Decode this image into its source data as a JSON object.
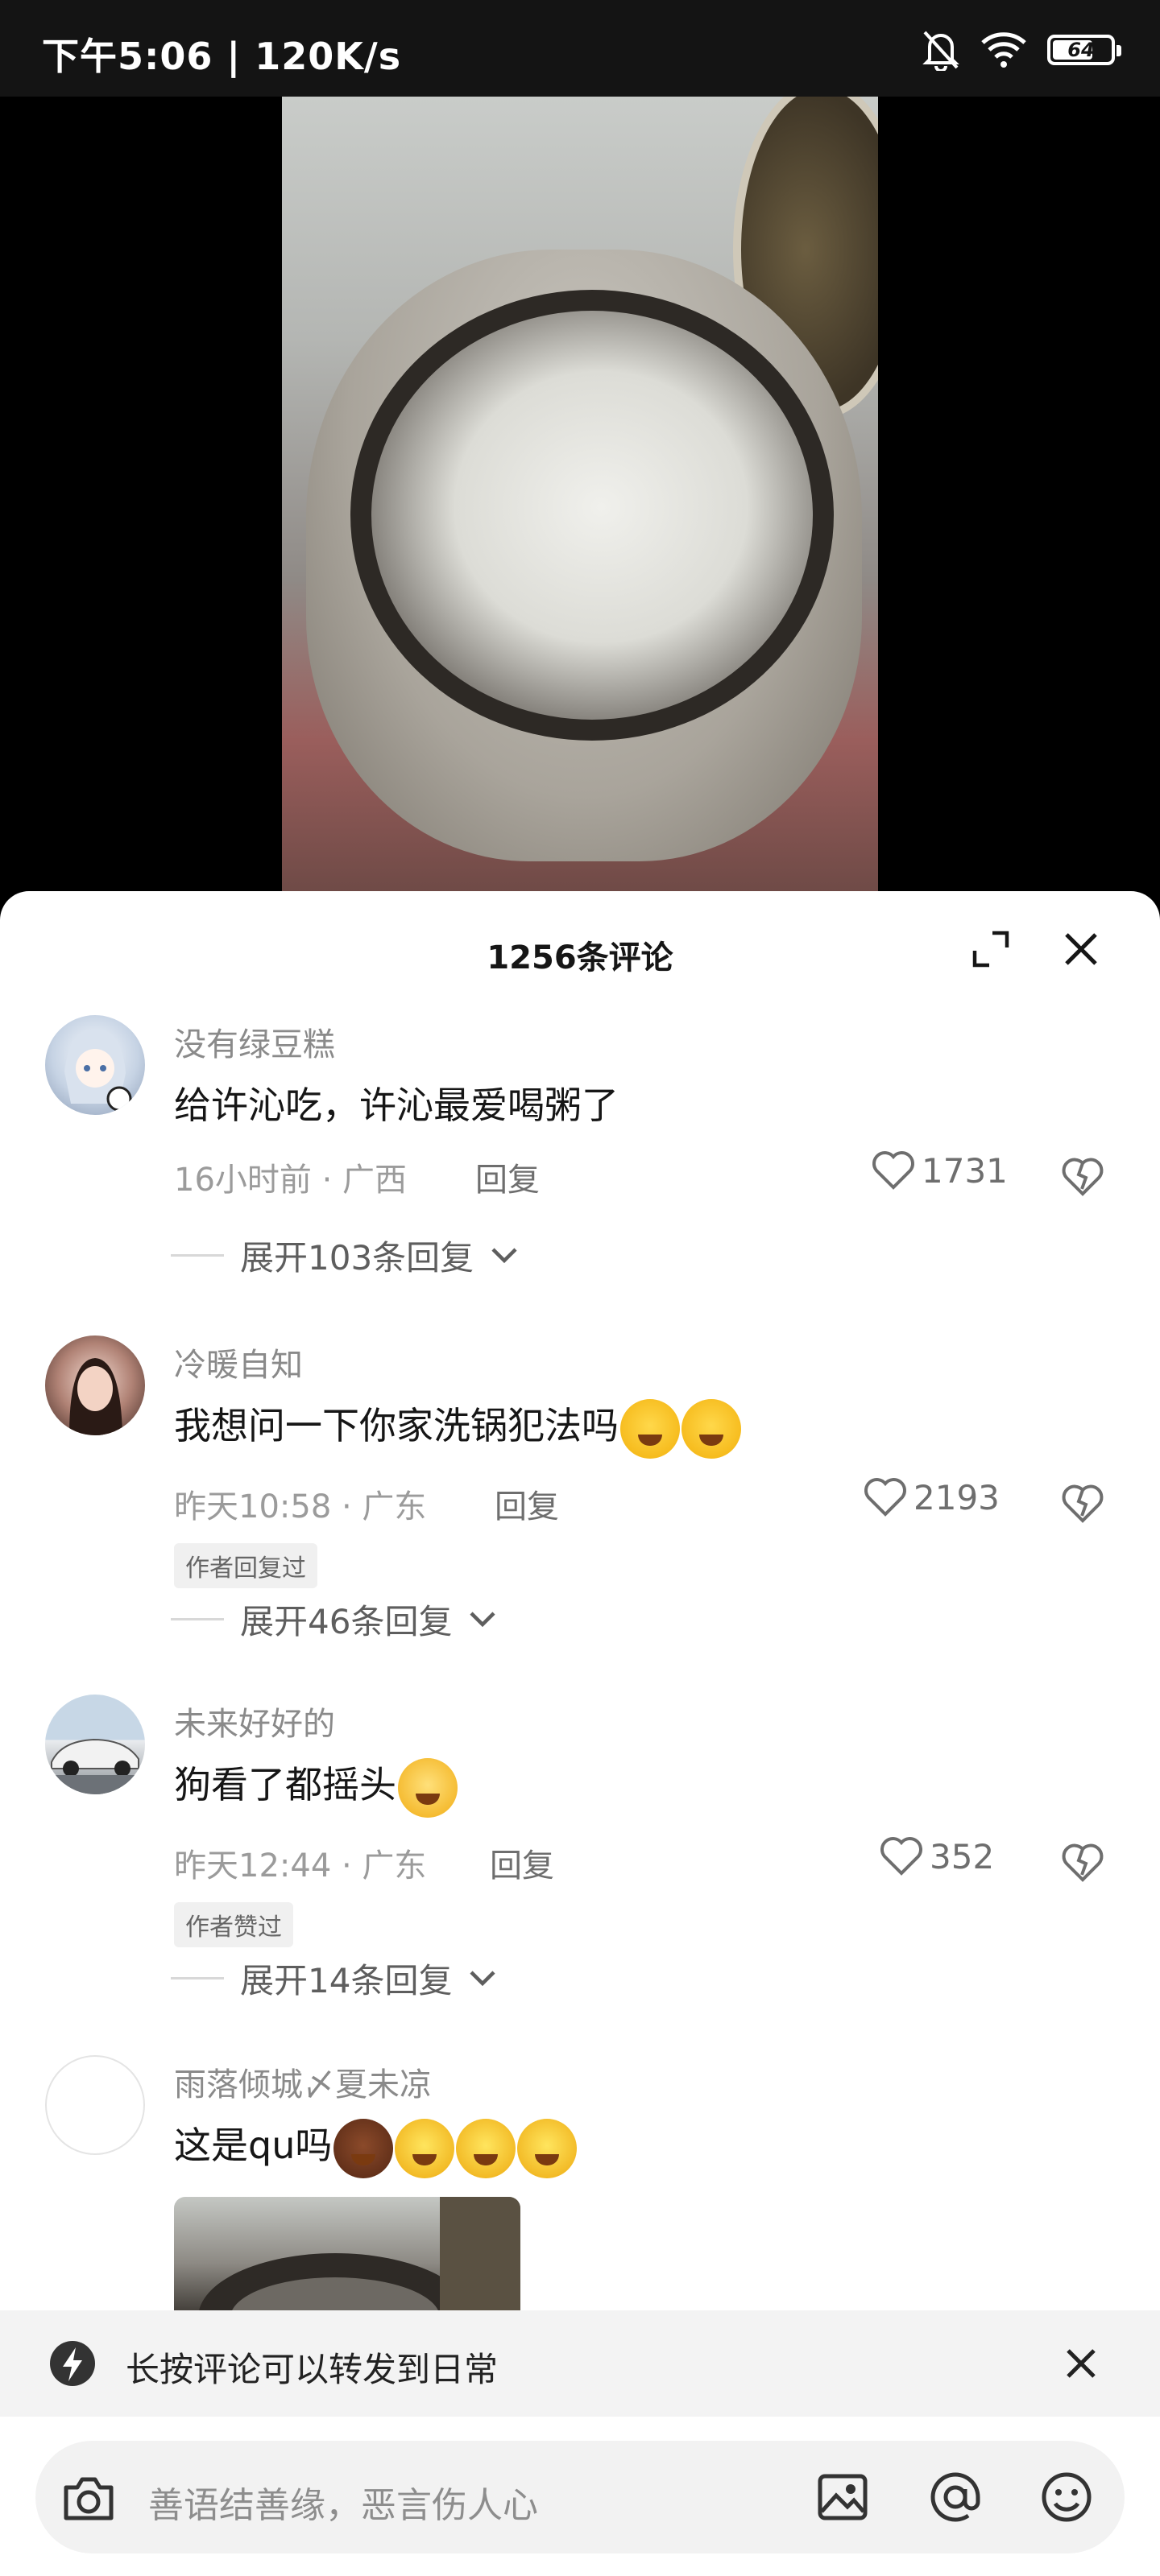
{
  "status_bar": {
    "time": "下午5:06 | 120K/s",
    "battery": "64",
    "battery_level": 0.64
  },
  "comments_panel": {
    "title": "1256条评论",
    "comments": [
      {
        "username": "没有绿豆糕",
        "text": "给许沁吃，许沁最爱喝粥了",
        "meta": "16小时前 · 广西",
        "reply_label": "回复",
        "likes": "1731",
        "expand_label": "展开103条回复"
      },
      {
        "username": "冷暖自知",
        "text": "我想问一下你家洗锅犯法吗",
        "meta": "昨天10:58 · 广东",
        "reply_label": "回复",
        "likes": "2193",
        "tag": "作者回复过",
        "expand_label": "展开46条回复"
      },
      {
        "username": "未来好好的",
        "text": "狗看了都摇头",
        "meta": "昨天12:44 · 广东",
        "reply_label": "回复",
        "likes": "352",
        "tag": "作者赞过",
        "expand_label": "展开14条回复"
      },
      {
        "username": "雨落倾城〆夏未凉",
        "text": "这是qu吗"
      }
    ]
  },
  "hint": {
    "text": "长按评论可以转发到日常"
  },
  "input_bar": {
    "placeholder": "善语结善缘，恶言伤人心"
  },
  "colors": {
    "accent_text": "#161616",
    "secondary_text": "#8a8a8a",
    "sheet_bg": "#ffffff"
  }
}
